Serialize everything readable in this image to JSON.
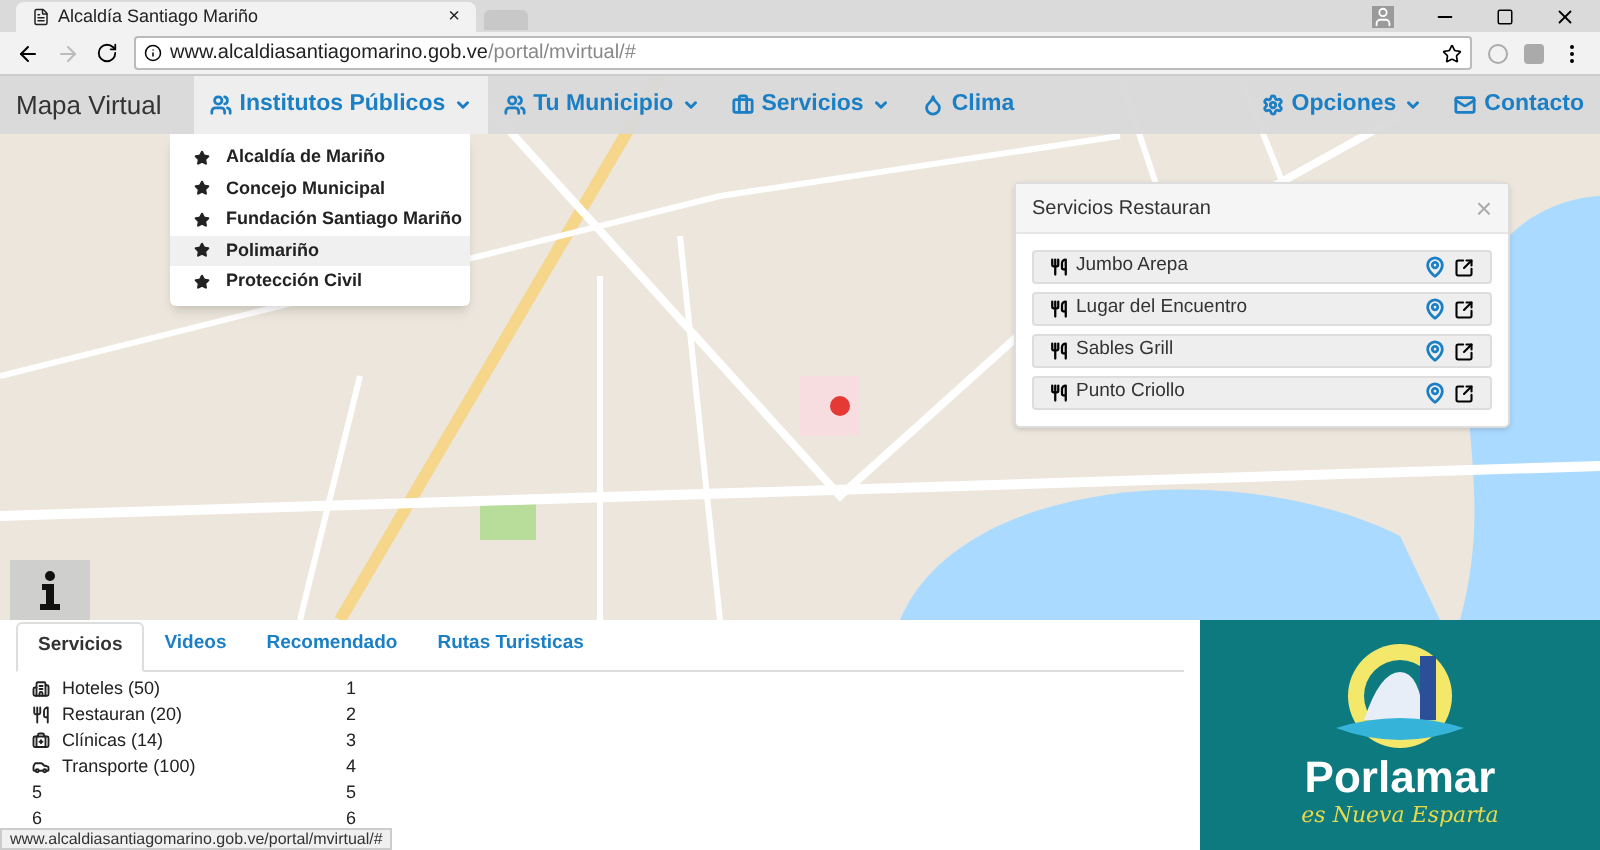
{
  "browser": {
    "tab_title": "Alcaldía Santiago Mariño",
    "tab_close": "×",
    "url_host": "www.alcaldiasantiagomarino.gob.ve",
    "url_path": "/portal/mvirtual/#",
    "status_url": "www.alcaldiasantiagomarino.gob.ve/portal/mvirtual/#"
  },
  "navbar": {
    "brand": "Mapa Virtual",
    "left_items": [
      {
        "label": "Institutos Públicos",
        "kind": "users",
        "dropdown": true,
        "selected": true
      },
      {
        "label": "Tu Municipio",
        "kind": "users",
        "dropdown": true,
        "selected": false
      },
      {
        "label": "Servicios",
        "kind": "briefcase",
        "dropdown": true,
        "selected": false
      },
      {
        "label": "Clima",
        "kind": "droplet",
        "dropdown": false,
        "selected": false
      }
    ],
    "right_items": [
      {
        "label": "Opciones",
        "kind": "cogs",
        "dropdown": true,
        "selected": false
      },
      {
        "label": "Contacto",
        "kind": "envelope",
        "dropdown": false,
        "selected": false
      }
    ]
  },
  "dropdown": {
    "items": [
      {
        "label": "Alcaldía de Mariño",
        "selected": false
      },
      {
        "label": "Concejo Municipal",
        "selected": false
      },
      {
        "label": "Fundación Santiago Mariño",
        "selected": false
      },
      {
        "label": "Polimariño",
        "selected": true
      },
      {
        "label": "Protección Civil",
        "selected": false
      }
    ]
  },
  "modal": {
    "title": "Servicios Restauran",
    "close": "×",
    "items": [
      {
        "name": "Jumbo Arepa"
      },
      {
        "name": "Lugar del Encuentro"
      },
      {
        "name": "Sables Grill"
      },
      {
        "name": "Punto Criollo"
      }
    ]
  },
  "tabs": [
    {
      "label": "Servicios",
      "selected": true
    },
    {
      "label": "Videos",
      "selected": false
    },
    {
      "label": "Recomendado",
      "selected": false
    },
    {
      "label": "Rutas Turisticas",
      "selected": false
    }
  ],
  "services": [
    {
      "kind": "hotel",
      "label": "Hoteles (50)",
      "column_2": "1"
    },
    {
      "kind": "utensils",
      "label": "Restauran (20)",
      "column_2": "2"
    },
    {
      "kind": "clinic",
      "label": "Clínicas (14)",
      "column_2": "3"
    },
    {
      "kind": "car",
      "label": "Transporte (100)",
      "column_2": "4"
    },
    {
      "label": "5",
      "column_2": "5"
    },
    {
      "label": "6",
      "column_2": "6"
    }
  ],
  "logo": {
    "title": "Porlamar",
    "subtitle": "es Nueva Esparta"
  }
}
